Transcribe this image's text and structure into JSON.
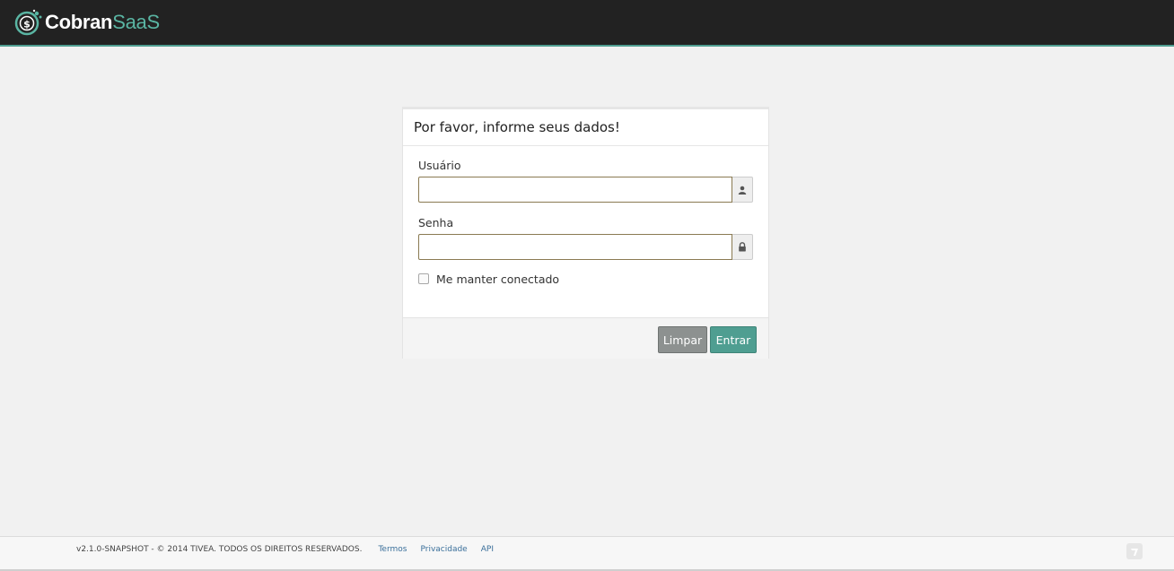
{
  "header": {
    "logo_part1": "Cobran",
    "logo_part2": "SaaS",
    "accent_color": "#4f9e91"
  },
  "login": {
    "title": "Por favor, informe seus dados!",
    "username_label": "Usuário",
    "username_value": "",
    "username_icon": "user-icon",
    "password_label": "Senha",
    "password_value": "",
    "password_icon": "lock-icon",
    "remember_label": "Me manter conectado",
    "remember_checked": false,
    "clear_button": "Limpar",
    "submit_button": "Entrar"
  },
  "footer": {
    "copyright": "v2.1.0-SNAPSHOT - © 2014 TIVEA. TODOS OS DIREITOS RESERVADOS.",
    "links": [
      "Termos",
      "Privacidade",
      "API"
    ],
    "badge_icon": "tivea-icon"
  }
}
